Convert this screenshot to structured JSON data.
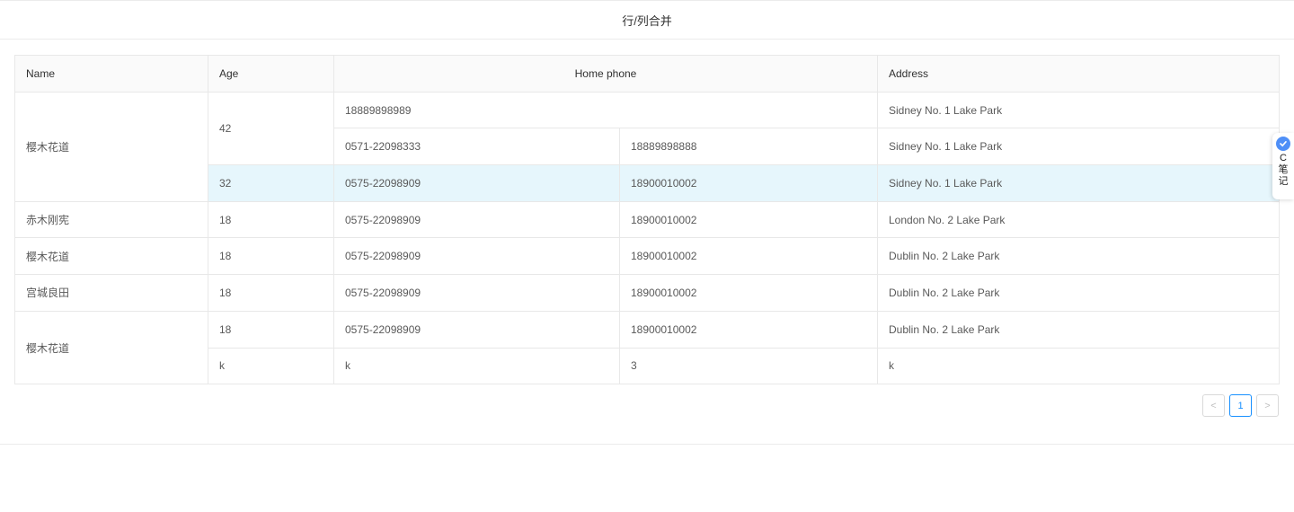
{
  "page": {
    "title": "行/列合并"
  },
  "table": {
    "headers": {
      "name": "Name",
      "age": "Age",
      "home_phone": "Home phone",
      "address": "Address"
    },
    "rows": [
      {
        "name": "樱木花道",
        "age": "42",
        "phone1": "18889898989",
        "address": "Sidney No. 1 Lake Park"
      },
      {
        "phone1": "0571-22098333",
        "phone2": "18889898888",
        "address": "Sidney No. 1 Lake Park"
      },
      {
        "age": "32",
        "phone1": "0575-22098909",
        "phone2": "18900010002",
        "address": "Sidney No. 1 Lake Park"
      },
      {
        "name": "赤木刚宪",
        "age": "18",
        "phone1": "0575-22098909",
        "phone2": "18900010002",
        "address": "London No. 2 Lake Park"
      },
      {
        "name": "樱木花道",
        "age": "18",
        "phone1": "0575-22098909",
        "phone2": "18900010002",
        "address": "Dublin No. 2 Lake Park"
      },
      {
        "name": "宫城良田",
        "age": "18",
        "phone1": "0575-22098909",
        "phone2": "18900010002",
        "address": "Dublin No. 2 Lake Park"
      },
      {
        "name": "樱木花道",
        "age": "18",
        "phone1": "0575-22098909",
        "phone2": "18900010002",
        "address": "Dublin No. 2 Lake Park"
      },
      {
        "age": "k",
        "phone1": "k",
        "phone2": "3",
        "address": "k"
      }
    ]
  },
  "pagination": {
    "prev": "<",
    "current": "1",
    "next": ">"
  },
  "side_widget": {
    "label": "C笔记",
    "icon": "note-icon",
    "color": "#4f8ff7"
  },
  "colors": {
    "highlight": "#e6f6fc",
    "accent": "#1890ff",
    "border": "#e8e8e8"
  }
}
